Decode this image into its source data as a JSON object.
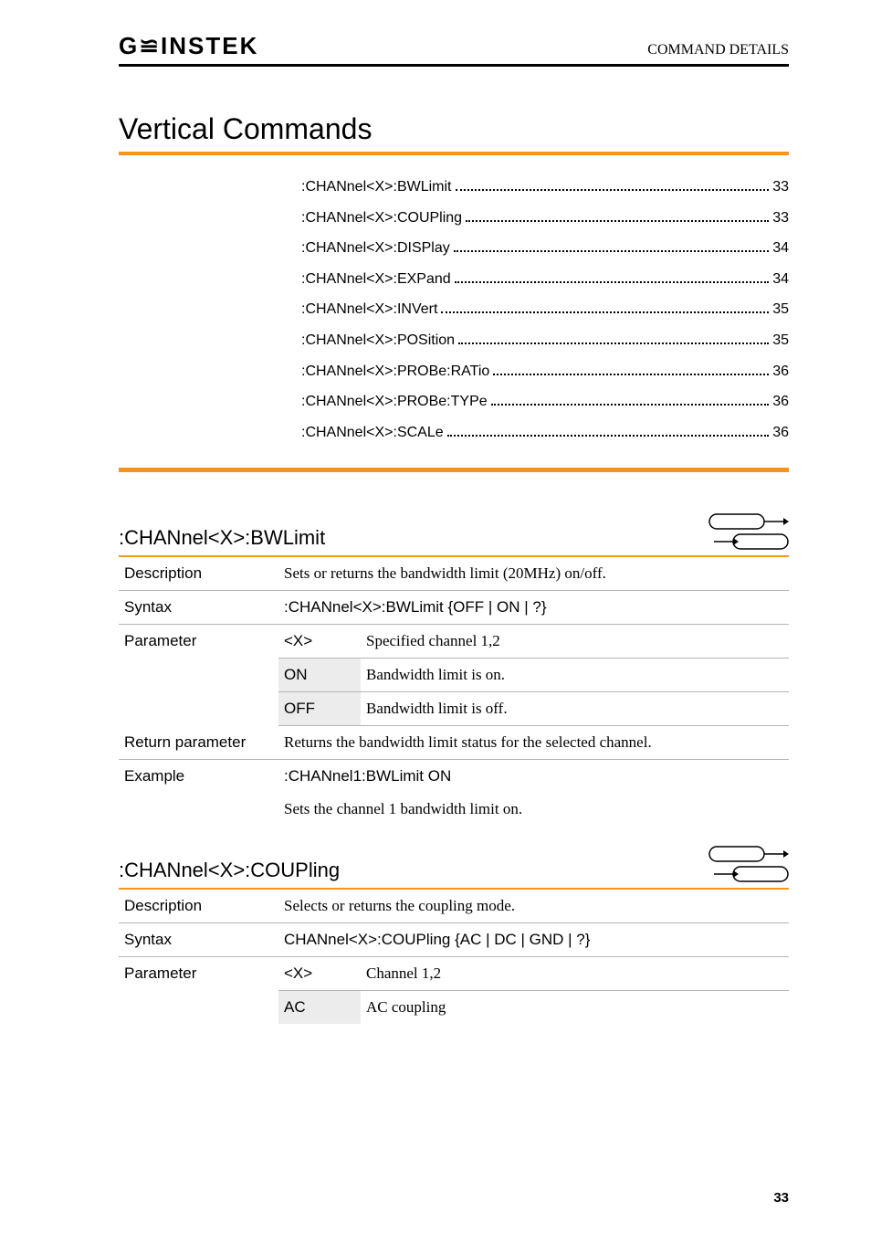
{
  "header": {
    "logo": "G≌INSTEK",
    "title": "COMMAND DETAILS"
  },
  "main_heading": "Vertical Commands",
  "toc": [
    {
      "label": ":CHANnel<X>:BWLimit",
      "page": "33"
    },
    {
      "label": ":CHANnel<X>:COUPling",
      "page": "33"
    },
    {
      "label": ":CHANnel<X>:DISPlay",
      "page": "34"
    },
    {
      "label": ":CHANnel<X>:EXPand",
      "page": "34"
    },
    {
      "label": ":CHANnel<X>:INVert",
      "page": "35"
    },
    {
      "label": ":CHANnel<X>:POSition",
      "page": "35"
    },
    {
      "label": ":CHANnel<X>:PROBe:RATio",
      "page": "36"
    },
    {
      "label": ":CHANnel<X>:PROBe:TYPe",
      "page": "36"
    },
    {
      "label": ":CHANnel<X>:SCALe",
      "page": "36"
    }
  ],
  "section1": {
    "heading": ":CHANnel<X>:BWLimit",
    "description_label": "Description",
    "description": "Sets or returns the bandwidth limit (20MHz) on/off.",
    "syntax_label": "Syntax",
    "syntax": ":CHANnel<X>:BWLimit {OFF | ON | ?}",
    "parameter_label": "Parameter",
    "params": [
      {
        "key": "<X>",
        "value": "Specified channel 1,2"
      },
      {
        "key": "ON",
        "value": "Bandwidth limit is on."
      },
      {
        "key": "OFF",
        "value": "Bandwidth limit is off."
      }
    ],
    "return_label": "Return parameter",
    "return_value": "Returns the bandwidth limit status for the selected channel.",
    "example_label": "Example",
    "example_code": ":CHANnel1:BWLimit ON",
    "example_desc": "Sets the channel 1 bandwidth limit on."
  },
  "section2": {
    "heading": ":CHANnel<X>:COUPling",
    "description_label": "Description",
    "description": "Selects or returns the coupling mode.",
    "syntax_label": "Syntax",
    "syntax": "CHANnel<X>:COUPling {AC | DC | GND | ?}",
    "parameter_label": "Parameter",
    "params": [
      {
        "key": "<X>",
        "value": "Channel 1,2"
      },
      {
        "key": "AC",
        "value": "AC coupling"
      }
    ]
  },
  "page_number": "33"
}
